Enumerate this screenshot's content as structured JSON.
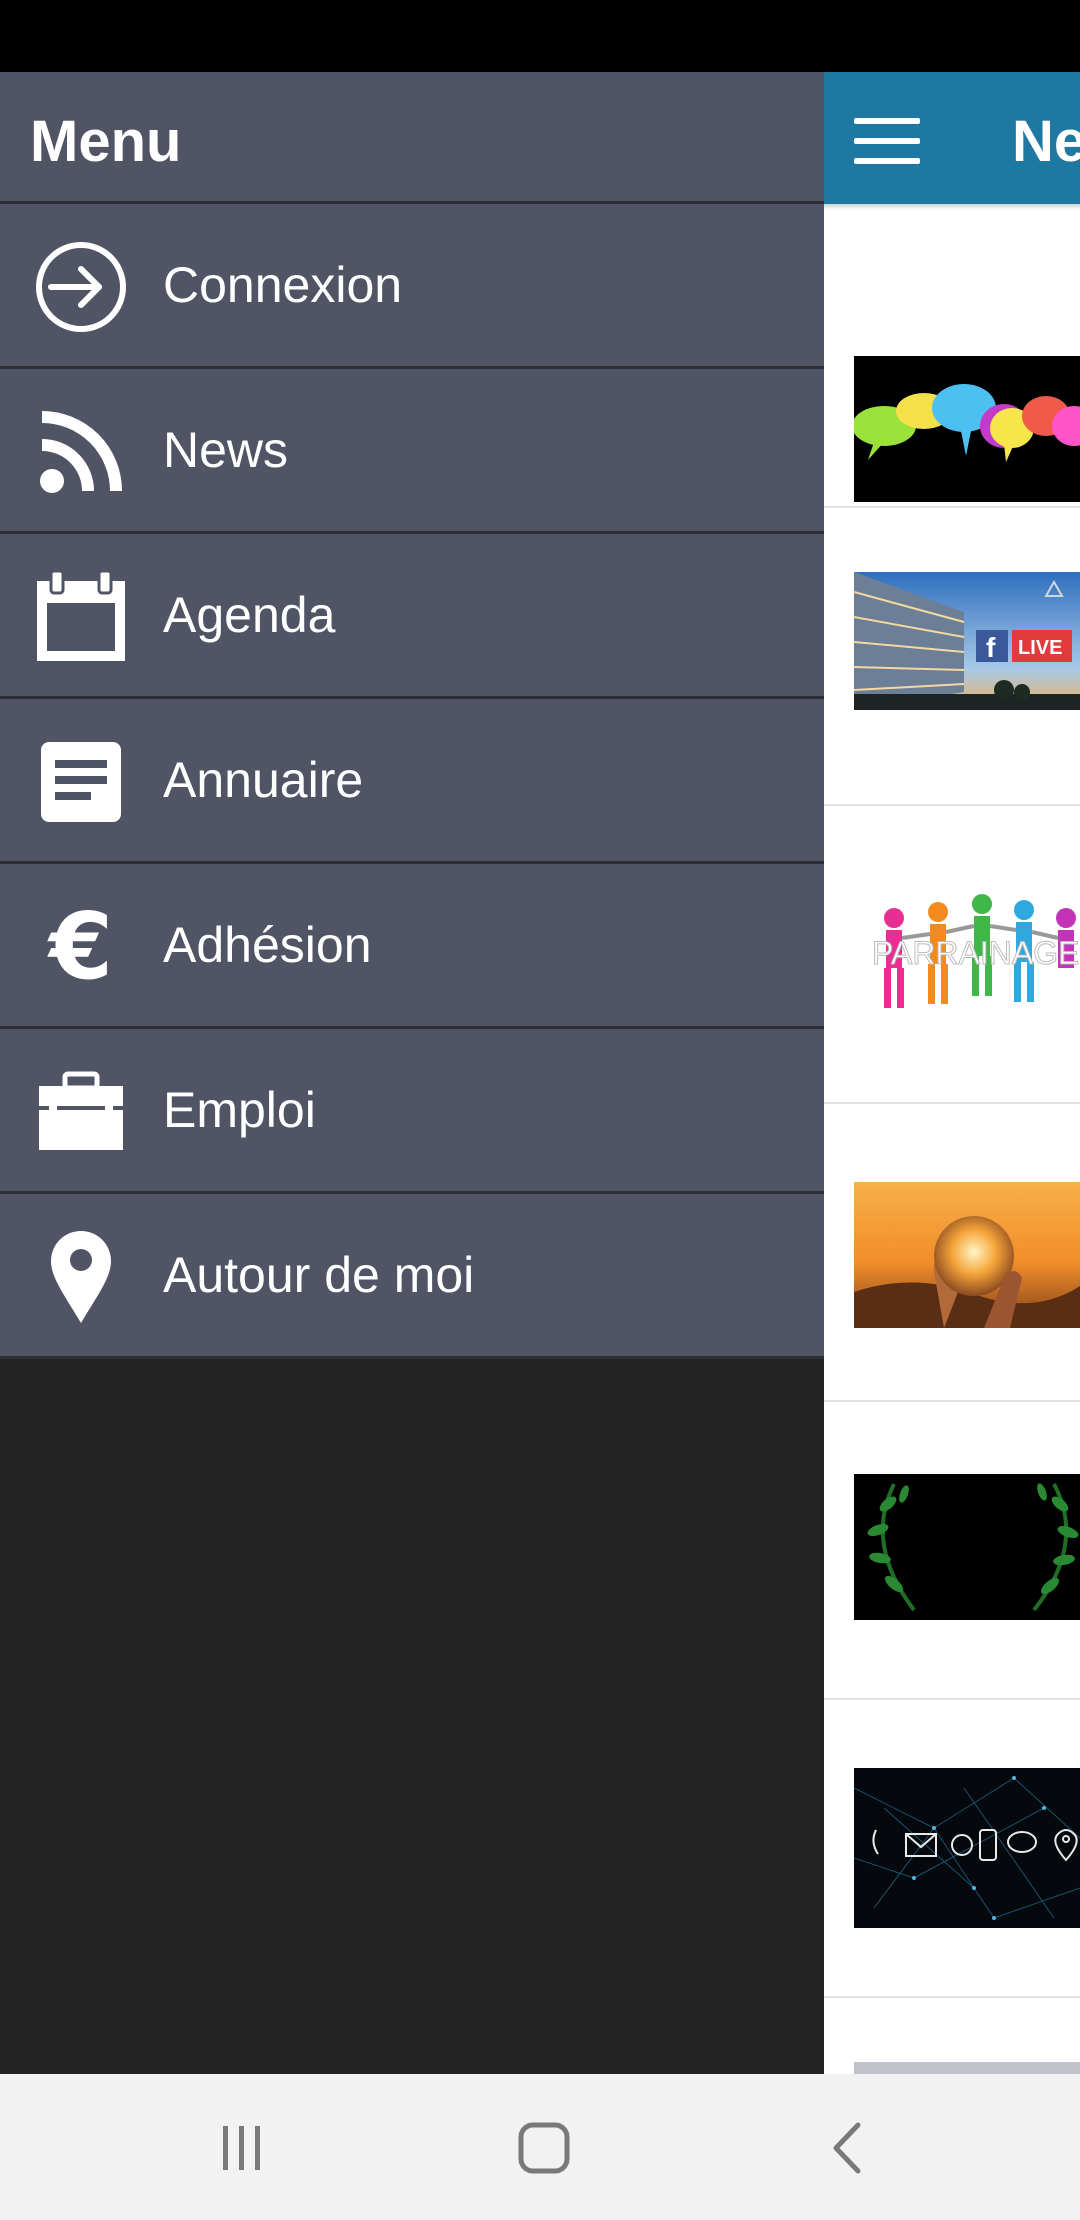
{
  "drawer": {
    "title": "Menu",
    "items": [
      {
        "label": "Connexion",
        "icon": "login-icon"
      },
      {
        "label": "News",
        "icon": "rss-icon"
      },
      {
        "label": "Agenda",
        "icon": "calendar-icon"
      },
      {
        "label": "Annuaire",
        "icon": "document-icon"
      },
      {
        "label": "Adhésion",
        "icon": "euro-icon"
      },
      {
        "label": "Emploi",
        "icon": "briefcase-icon"
      },
      {
        "label": "Autour de moi",
        "icon": "location-pin-icon"
      }
    ]
  },
  "news_page": {
    "title": "News",
    "header_color": "#1f78a2",
    "thumbnails": [
      "speech-bubbles-image",
      "facebook-live-building-image",
      "parrainage-people-image",
      "crystal-ball-sunset-image",
      "laurel-wreath-image",
      "network-contact-icons-image",
      "partial-image"
    ],
    "thumbnail_text": {
      "live": "LIVE",
      "parrainage": "PARRAINAGE"
    }
  },
  "colors": {
    "drawer_item_bg": "#505464",
    "drawer_bg": "#232323",
    "divider": "#2c2f38",
    "nav_bar_bg": "#f2f2f2"
  },
  "system_nav": {
    "buttons": [
      "recent-apps-button",
      "home-button",
      "back-button"
    ]
  }
}
